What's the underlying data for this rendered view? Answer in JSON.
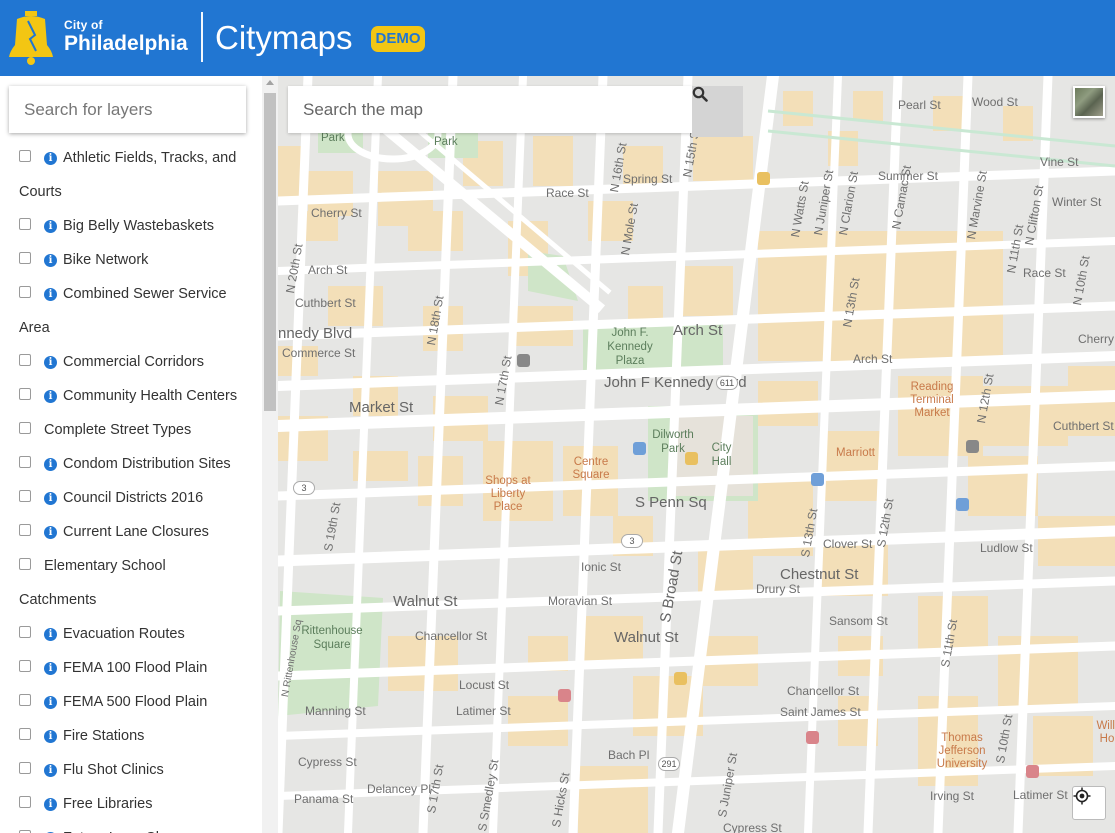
{
  "header": {
    "brand_small": "City of",
    "brand_big": "Philadelphia",
    "app_title": "Citymaps",
    "badge": "DEMO",
    "logo_icon": "liberty-bell-icon",
    "colors": {
      "bar": "#2176d2",
      "badge": "#f3c613"
    }
  },
  "sidebar": {
    "search_placeholder": "Search for layers",
    "layers": [
      {
        "label": "Athletic Fields, Tracks, and",
        "cont": "Courts",
        "info": true
      },
      {
        "label": "Big Belly Wastebaskets",
        "info": true
      },
      {
        "label": "Bike Network",
        "info": true
      },
      {
        "label": "Combined Sewer Service",
        "cont": "Area",
        "info": true
      },
      {
        "label": "Commercial Corridors",
        "info": true
      },
      {
        "label": "Community Health Centers",
        "info": true
      },
      {
        "label": "Complete Street Types",
        "info": false
      },
      {
        "label": "Condom Distribution Sites",
        "info": true
      },
      {
        "label": "Council Districts 2016",
        "info": true
      },
      {
        "label": "Current Lane Closures",
        "info": true
      },
      {
        "label": "Elementary School",
        "cont": "Catchments",
        "info": false
      },
      {
        "label": "Evacuation Routes",
        "info": true
      },
      {
        "label": "FEMA 100 Flood Plain",
        "info": true
      },
      {
        "label": "FEMA 500 Flood Plain",
        "info": true
      },
      {
        "label": "Fire Stations",
        "info": true
      },
      {
        "label": "Flu Shot Clinics",
        "info": true
      },
      {
        "label": "Free Libraries",
        "info": true
      },
      {
        "label": "Future Lane Closures",
        "info": true
      }
    ]
  },
  "map": {
    "search_placeholder": "Search the map",
    "search_icon": "search-icon",
    "basemap_icon": "aerial-basemap-icon",
    "locate_icon": "locate-icon",
    "labels": {
      "park1": "Park",
      "park2": "Park",
      "pearl": "Pearl St",
      "wood": "Wood St",
      "vine": "Vine St",
      "summer": "Summer St",
      "winter": "Winter St",
      "race1": "Race St",
      "race2": "Race St",
      "spring": "Spring St",
      "cherry1": "Cherry St",
      "cherry2": "Cherry",
      "arch1": "Arch St",
      "arch2": "Arch St",
      "arch3": "Arch St",
      "cuthbert1": "Cuthbert St",
      "cuthbert2": "Cuthbert St",
      "kennedy_blvd": "nnedy Blvd",
      "commerce": "Commerce St",
      "jfk_blvd": "John F Kennedy Blvd",
      "market": "Market St",
      "penn_sq": "S Penn Sq",
      "chestnut": "Chestnut St",
      "clover": "Clover St",
      "ludlow": "Ludlow St",
      "ionic": "Ionic St",
      "drury": "Drury St",
      "moravian": "Moravian St",
      "walnut1": "Walnut St",
      "walnut2": "Walnut St",
      "sansom": "Sansom St",
      "chancellor1": "Chancellor St",
      "chancellor2": "Chancellor St",
      "locust": "Locust St",
      "latimer1": "Latimer St",
      "latimer2": "Latimer St",
      "saint_james": "Saint James St",
      "manning": "Manning St",
      "cypress1": "Cypress St",
      "cypress2": "Cypress St",
      "bach": "Bach Pl",
      "panama": "Panama St",
      "delancey": "Delancey Pl",
      "irving": "Irving St",
      "broad": "S Broad St",
      "n15": "N 15th St",
      "n16": "N 16th St",
      "n18": "N 18th St",
      "n17": "N 17th St",
      "n20": "N 20th St",
      "n13": "N 13th St",
      "n12": "N 12th St",
      "n11": "N 11th St",
      "n10": "N 10th St",
      "mole": "N Mole St",
      "walts": "N Watts St",
      "juniper": "N Juniper St",
      "clarion": "N Clarion St",
      "camac": "N Camac St",
      "marvine": "N Marvine St",
      "clifton": "N Clifton St",
      "s19": "S 19th St",
      "s18": "S 18th St",
      "s17": "S 17th St",
      "s16": "S 16th St",
      "s15": "S 15th St",
      "s13": "S 13th St",
      "s12": "S 12th St",
      "s11": "S 11th St",
      "s10": "S 10th St",
      "s_juniper": "S Juniper St",
      "s_hicks": "S Hicks St",
      "s_smedley": "S Smedley St",
      "rittenhouse_st": "N Rittenhouse Sq",
      "jfk_plaza": "John F. Kennedy Plaza",
      "dilworth": "Dilworth Park",
      "city_hall": "City Hall",
      "centre_sq": "Centre Square",
      "shops_liberty": "Shops at Liberty Place",
      "reading": "Reading Terminal Market",
      "marriott": "Marriott",
      "rittenhouse_sq": "Rittenhouse Square",
      "thomas_jefferson": "Thomas Jefferson University",
      "willi": "Willi Ho",
      "r611": "611",
      "r3a": "3",
      "r3b": "3",
      "r291": "291"
    }
  }
}
